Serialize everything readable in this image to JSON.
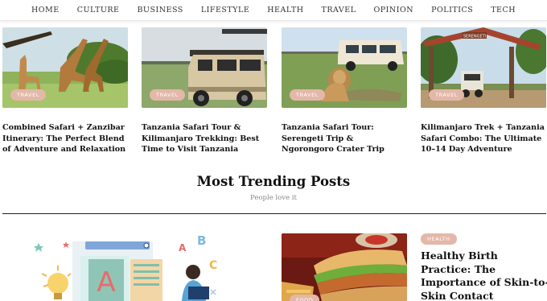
{
  "nav": {
    "items": [
      "HOME",
      "CULTURE",
      "BUSINESS",
      "LIFESTYLE",
      "HEALTH",
      "TRAVEL",
      "OPINION",
      "POLITICS",
      "TECH"
    ]
  },
  "cards": [
    {
      "tag": "TRAVEL",
      "title": "Combined Safari + Zanzibar Itinerary: The Perfect Blend of Adventure and Relaxation"
    },
    {
      "tag": "TRAVEL",
      "title": "Tanzania Safari Tour & Kilimanjaro Trekking: Best Time to Visit Tanzania"
    },
    {
      "tag": "TRAVEL",
      "title": "Tanzania Safari Tour: Serengeti Trip & Ngorongoro Crater Trip"
    },
    {
      "tag": "TRAVEL",
      "title": "Kilimanjaro Trek + Tanzania Safari Combo: The Ultimate 10–14 Day Adventure"
    }
  ],
  "trending": {
    "title": "Most Trending Posts",
    "subtitle": "People love it"
  },
  "featured": {
    "food_tag": "FOOD",
    "health_tag": "HEALTH",
    "health_title": "Healthy Birth Practice: The Importance of Skin-to-Skin Contact",
    "illus_letters": [
      "A",
      "B",
      "C"
    ],
    "sign_text": "SERENGETI"
  },
  "colors": {
    "tag_bg": "#e3b8a8",
    "divider": "#222222"
  }
}
